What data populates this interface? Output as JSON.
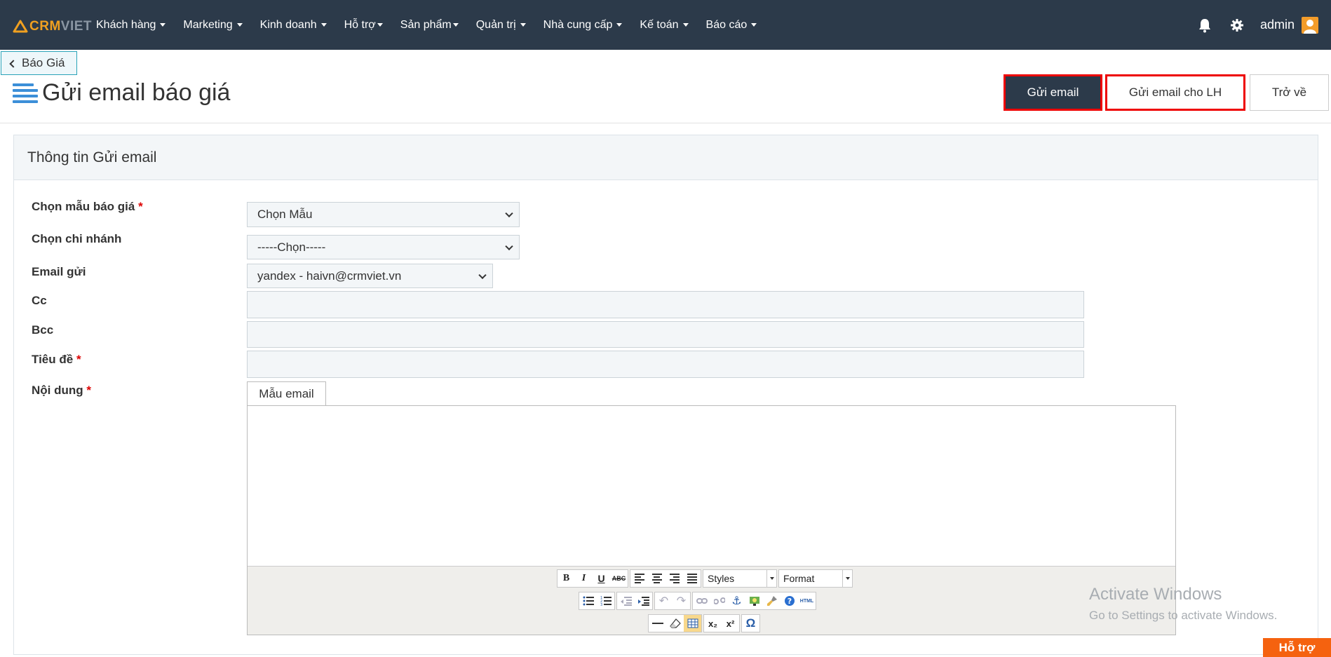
{
  "logo": {
    "part1": "CRM",
    "part2": "VIET"
  },
  "nav": [
    {
      "label": "Khách hàng"
    },
    {
      "label": "Marketing"
    },
    {
      "label": "Kinh doanh"
    },
    {
      "label": "Hỗ trợ"
    },
    {
      "label": "Sản phẩm"
    },
    {
      "label": "Quản trị"
    },
    {
      "label": "Nhà cung cấp"
    },
    {
      "label": "Kế toán"
    },
    {
      "label": "Báo cáo"
    }
  ],
  "user": {
    "name": "admin"
  },
  "icons": {
    "notification": "bell-icon",
    "settings": "gear-icon",
    "avatar": "user-avatar-icon",
    "title": "list-icon",
    "back": "chevron-left-icon"
  },
  "colors": {
    "topbar": "#2c3a4a",
    "accent": "#f0a020",
    "highlight": "#e00000",
    "support": "#f5620f"
  },
  "back_link": {
    "label": "Báo Giá"
  },
  "page": {
    "title": "Gửi email báo giá"
  },
  "actions": {
    "send": "Gửi email",
    "send_lh": "Gửi email cho LH",
    "back": "Trở về"
  },
  "panel": {
    "title": "Thông tin Gửi email"
  },
  "form": {
    "template": {
      "label": "Chọn mẫu báo giá",
      "value": "Chọn Mẫu"
    },
    "branch": {
      "label": "Chọn chi nhánh",
      "value": "-----Chọn-----"
    },
    "sender": {
      "label": "Email gửi",
      "value": "yandex - haivn@crmviet.vn"
    },
    "cc": {
      "label": "Cc",
      "value": ""
    },
    "bcc": {
      "label": "Bcc",
      "value": ""
    },
    "subject": {
      "label": "Tiêu đề",
      "value": ""
    },
    "content": {
      "label": "Nội dung",
      "template_button": "Mẫu email"
    },
    "required_mark": "*"
  },
  "editor": {
    "styles_label": "Styles",
    "format_label": "Format",
    "buttons": {
      "bold": "B",
      "italic": "I",
      "underline": "U",
      "strike": "ABC",
      "html": "HTML",
      "sub": "x₂",
      "sup": "x²",
      "omega": "Ω"
    }
  },
  "watermark": {
    "line1": "Activate Windows",
    "line2": "Go to Settings to activate Windows."
  },
  "support": {
    "label": "Hỗ trợ"
  }
}
